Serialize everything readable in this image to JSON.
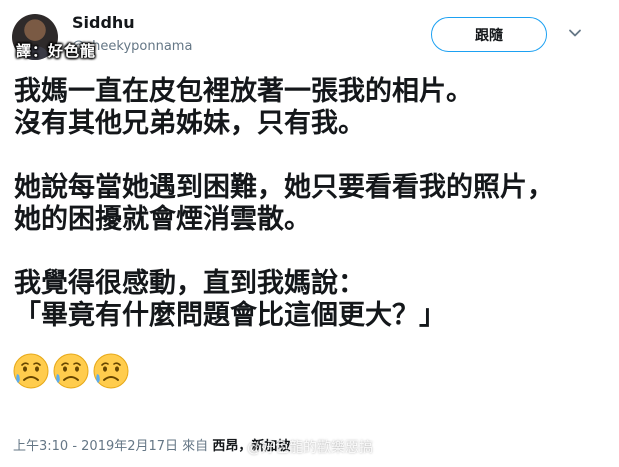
{
  "author": {
    "display_name": "Siddhu",
    "handle": "@cheekyponnama",
    "avatar_icon": "profile-avatar"
  },
  "translator_tag": "譯：好色龍",
  "follow_button": {
    "label": "跟隨"
  },
  "menu_icon": "chevron-down-icon",
  "tweet": {
    "paragraphs": [
      {
        "lines": [
          "我媽一直在皮包裡放著一張我的相片。",
          "沒有其他兄弟姊妹，只有我。"
        ]
      },
      {
        "lines": [
          "她說每當她遇到困難，她只要看看我的照片，",
          "她的困擾就會煙消雲散。"
        ]
      },
      {
        "lines": [
          "我覺得很感動，直到我媽說：",
          "「畢竟有什麼問題會比這個更大？」"
        ]
      }
    ],
    "emojis": [
      "disappointed-relieved-face",
      "disappointed-relieved-face",
      "disappointed-relieved-face"
    ]
  },
  "timestamp": {
    "text": "上午3:10 - 2019年2月17日 來自 ",
    "location": "西昂，新加坡"
  },
  "watermark": "@好色龍的歡樂惡搞",
  "colors": {
    "accent": "#1da1f2",
    "text": "#14171a",
    "muted": "#657786"
  }
}
